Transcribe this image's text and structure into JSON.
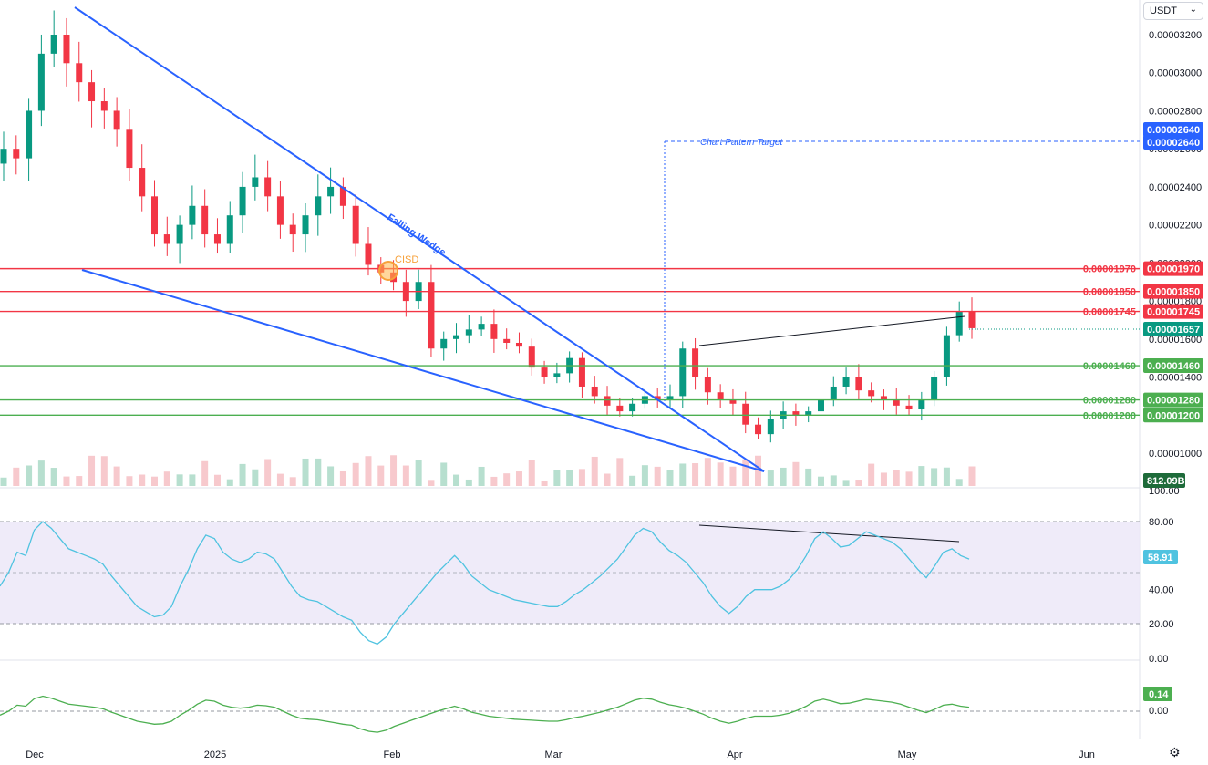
{
  "currency_selector": {
    "label": "USDT",
    "chevron_icon": "chevron-down-icon"
  },
  "settings_icon": "gear-icon",
  "price_axis": {
    "ticks": [
      "0.00003200",
      "0.00003000",
      "0.00002800",
      "0.00002600",
      "0.00002400",
      "0.00002200",
      "0.00002000",
      "0.00001800",
      "0.00001600",
      "0.00001400",
      "0.00001000"
    ],
    "last_price": "0.00001657",
    "target_price": "0.00002640",
    "volume_label": "812.09B"
  },
  "time_axis": [
    "Dec",
    "2025",
    "Feb",
    "Mar",
    "Apr",
    "May",
    "Jun"
  ],
  "levels": [
    {
      "value": "0.00001970",
      "color": "#f23645"
    },
    {
      "value": "0.00001850",
      "color": "#f23645"
    },
    {
      "value": "0.00001745",
      "color": "#f23645"
    },
    {
      "value": "0.00001460",
      "color": "#4caf50"
    },
    {
      "value": "0.00001280",
      "color": "#4caf50"
    },
    {
      "value": "0.00001200",
      "color": "#4caf50"
    }
  ],
  "annotations": {
    "wedge_label": "Falling Wedge",
    "cisd_label": "CISD",
    "target_label": "Chart Pattern Target"
  },
  "rsi": {
    "ticks": [
      "100.00",
      "80.00",
      "40.00",
      "20.00",
      "0.00"
    ],
    "value": "58.91",
    "color": "#4fc3e0",
    "band_color": "#ece7f8",
    "series": [
      42,
      62,
      75,
      80,
      74,
      66,
      62,
      60,
      55,
      50,
      42,
      35,
      30,
      27,
      25,
      32,
      46,
      60,
      75,
      70,
      60,
      58,
      57,
      62,
      60,
      55,
      45,
      38,
      34,
      30,
      27,
      25,
      20,
      10,
      8,
      14,
      22,
      28,
      36,
      44,
      54,
      62,
      60,
      52,
      46,
      44,
      40,
      36,
      34,
      33,
      32,
      30,
      34,
      38,
      42,
      46,
      50,
      55,
      62,
      70,
      76,
      72,
      62,
      55,
      44,
      32,
      28,
      25,
      33,
      38,
      40,
      42,
      48,
      58,
      70,
      75,
      68,
      64,
      66,
      72,
      74,
      70,
      66,
      58,
      50,
      54,
      62,
      60
    ],
    "series_top": [
      42,
      50,
      62,
      60,
      75,
      80,
      76,
      70,
      64,
      62,
      60,
      58,
      55,
      48,
      42,
      36,
      30,
      27,
      24,
      25,
      30,
      42,
      52,
      64,
      72,
      70,
      62,
      58,
      56,
      58,
      62,
      61,
      58,
      50,
      42,
      36,
      34,
      33,
      30,
      27,
      24,
      22,
      15,
      10,
      8,
      12,
      20,
      26,
      32,
      38,
      44,
      50,
      55,
      60,
      55,
      48,
      44,
      40,
      38,
      36,
      34,
      33,
      32,
      31,
      30,
      30,
      33,
      37,
      40,
      44,
      48,
      53,
      58,
      65,
      72,
      76,
      74,
      68,
      63,
      60,
      56,
      50,
      44,
      36,
      30,
      26,
      30,
      36,
      40,
      40,
      40,
      42,
      46,
      52,
      60,
      70,
      74,
      70,
      65,
      66,
      70,
      74,
      72,
      70,
      68,
      64,
      58,
      52,
      47,
      54,
      62,
      64,
      60,
      58
    ]
  },
  "osc": {
    "ticks": [
      "0.00"
    ],
    "value": "0.14",
    "color": "#4caf50"
  },
  "chart_data": {
    "type": "line",
    "title": "",
    "series": [
      {
        "name": "",
        "values": [
          2.6e-05,
          2.55e-05,
          2.8e-05,
          3.1e-05,
          3.2e-05,
          3.05e-05,
          2.95e-05,
          2.85e-05,
          2.8e-05,
          2.7e-05,
          2.5e-05,
          2.35e-05,
          2.15e-05,
          2.1e-05,
          2.2e-05,
          2.3e-05,
          2.15e-05,
          2.1e-05,
          2.25e-05,
          2.4e-05,
          2.45e-05,
          2.35e-05,
          2.2e-05,
          2.15e-05,
          2.25e-05,
          2.35e-05,
          2.4e-05,
          2.3e-05,
          2.1e-05,
          1.99e-05,
          1.95e-05,
          1.9e-05,
          1.8e-05,
          1.9e-05,
          1.55e-05,
          1.6e-05,
          1.62e-05,
          1.65e-05,
          1.68e-05,
          1.6e-05,
          1.58e-05,
          1.56e-05,
          1.45e-05,
          1.4e-05,
          1.42e-05,
          1.5e-05,
          1.35e-05,
          1.3e-05,
          1.25e-05,
          1.22e-05,
          1.26e-05,
          1.3e-05,
          1.28e-05,
          1.3e-05,
          1.55e-05,
          1.4e-05,
          1.32e-05,
          1.28e-05,
          1.26e-05,
          1.15e-05,
          1.1e-05,
          1.18e-05,
          1.22e-05,
          1.2e-05,
          1.22e-05,
          1.28e-05,
          1.35e-05,
          1.4e-05,
          1.33e-05,
          1.3e-05,
          1.28e-05,
          1.25e-05,
          1.23e-05,
          1.28e-05,
          1.4e-05,
          1.62e-05,
          1.745e-05,
          1.657e-05
        ]
      }
    ],
    "xlabel": "",
    "ylabel": "",
    "ylim": [
      9e-06,
      3.35e-05
    ],
    "grid": false
  }
}
